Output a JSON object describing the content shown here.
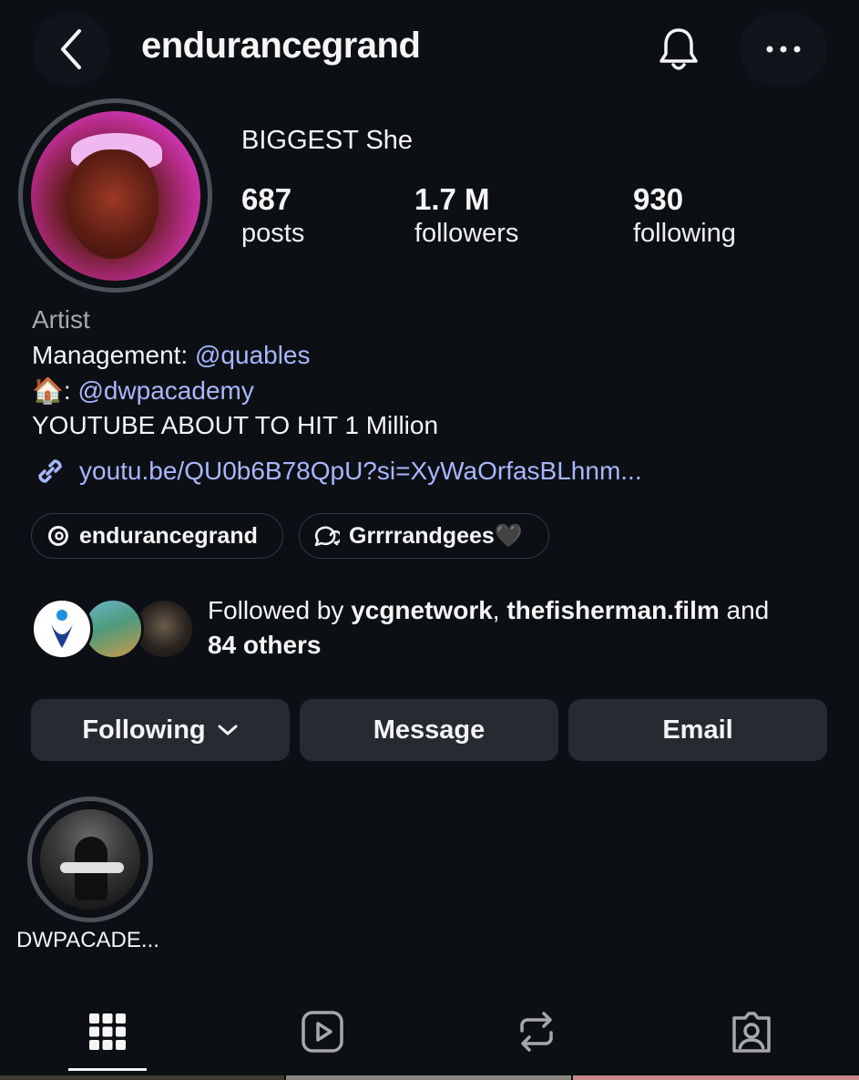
{
  "header": {
    "username": "endurancegrand",
    "back_icon": "chevron-left-icon",
    "bell_icon": "bell-icon",
    "more_icon": "more-horizontal-icon"
  },
  "profile": {
    "display_name": "BIGGEST She",
    "stats": [
      {
        "value": "687",
        "label": "posts"
      },
      {
        "value": "1.7 M",
        "label": "followers"
      },
      {
        "value": "930",
        "label": "following"
      }
    ]
  },
  "bio": {
    "category": "Artist",
    "management_prefix": "Management: ",
    "management_handle": "@quables",
    "house_emoji": "🏠",
    "house_sep": ": ",
    "house_handle": "@dwpacademy",
    "line3": "YOUTUBE ABOUT TO HIT 1 Million",
    "link": "youtu.be/QU0b6B78QpU?si=XyWaOrfasBLhnm..."
  },
  "chips": [
    {
      "label": "endurancegrand",
      "icon": "threads-icon"
    },
    {
      "label": "Grrrrandgees🖤",
      "icon": "chat-bubbles-icon"
    }
  ],
  "followed_by": {
    "prefix": "Followed by ",
    "name1": "ycgnetwork",
    "sep": ", ",
    "name2": "thefisherman.film",
    "and": " and",
    "others": "84 others"
  },
  "actions": {
    "following": "Following",
    "message": "Message",
    "email": "Email"
  },
  "highlights": [
    {
      "label": "DWPACADE..."
    }
  ],
  "tabs": [
    {
      "icon": "grid-icon",
      "active": true
    },
    {
      "icon": "reels-icon",
      "active": false
    },
    {
      "icon": "repost-icon",
      "active": false
    },
    {
      "icon": "tagged-icon",
      "active": false
    }
  ],
  "colors": {
    "background": "#0c1014",
    "link": "#a8b6ff",
    "button_bg": "#262b31"
  }
}
